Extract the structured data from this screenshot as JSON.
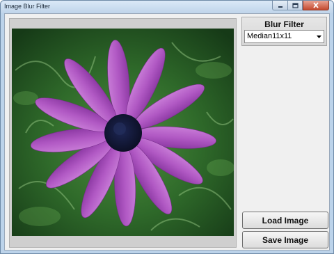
{
  "window": {
    "title": "Image Blur Filter"
  },
  "filter": {
    "label": "Blur Filter",
    "selected": "Median11x11"
  },
  "buttons": {
    "load": "Load Image",
    "save": "Save Image"
  },
  "icons": {
    "minimize": "minimize-icon",
    "maximize": "maximize-icon",
    "close": "close-icon",
    "dropdown": "chevron-down-icon"
  },
  "colors": {
    "petal": "#b159c4",
    "flower_center": "#141838",
    "foliage": "#2f6a2a",
    "close_button": "#c44a2f"
  }
}
